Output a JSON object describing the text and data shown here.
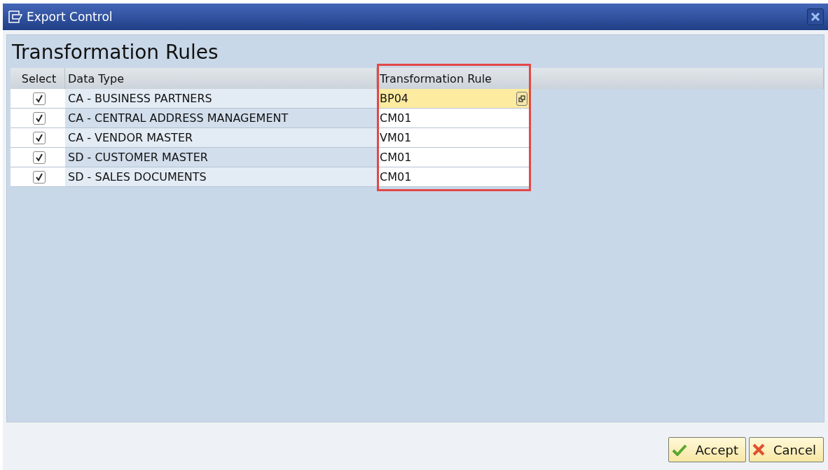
{
  "window": {
    "title": "Export Control"
  },
  "heading": "Transformation Rules",
  "table": {
    "columns": [
      "Select",
      "Data Type",
      "Transformation Rule"
    ],
    "rows": [
      {
        "checked": true,
        "data_type": "CA - BUSINESS PARTNERS",
        "rule": "BP04",
        "focused": true
      },
      {
        "checked": true,
        "data_type": "CA - CENTRAL ADDRESS MANAGEMENT",
        "rule": "CM01",
        "focused": false
      },
      {
        "checked": true,
        "data_type": "CA - VENDOR MASTER",
        "rule": "VM01",
        "focused": false
      },
      {
        "checked": true,
        "data_type": "SD - CUSTOMER MASTER",
        "rule": "CM01",
        "focused": false
      },
      {
        "checked": true,
        "data_type": "SD - SALES DOCUMENTS",
        "rule": "CM01",
        "focused": false
      }
    ]
  },
  "buttons": [
    {
      "kind": "accept",
      "label": "Accept"
    },
    {
      "kind": "cancel",
      "label": "Cancel"
    }
  ]
}
